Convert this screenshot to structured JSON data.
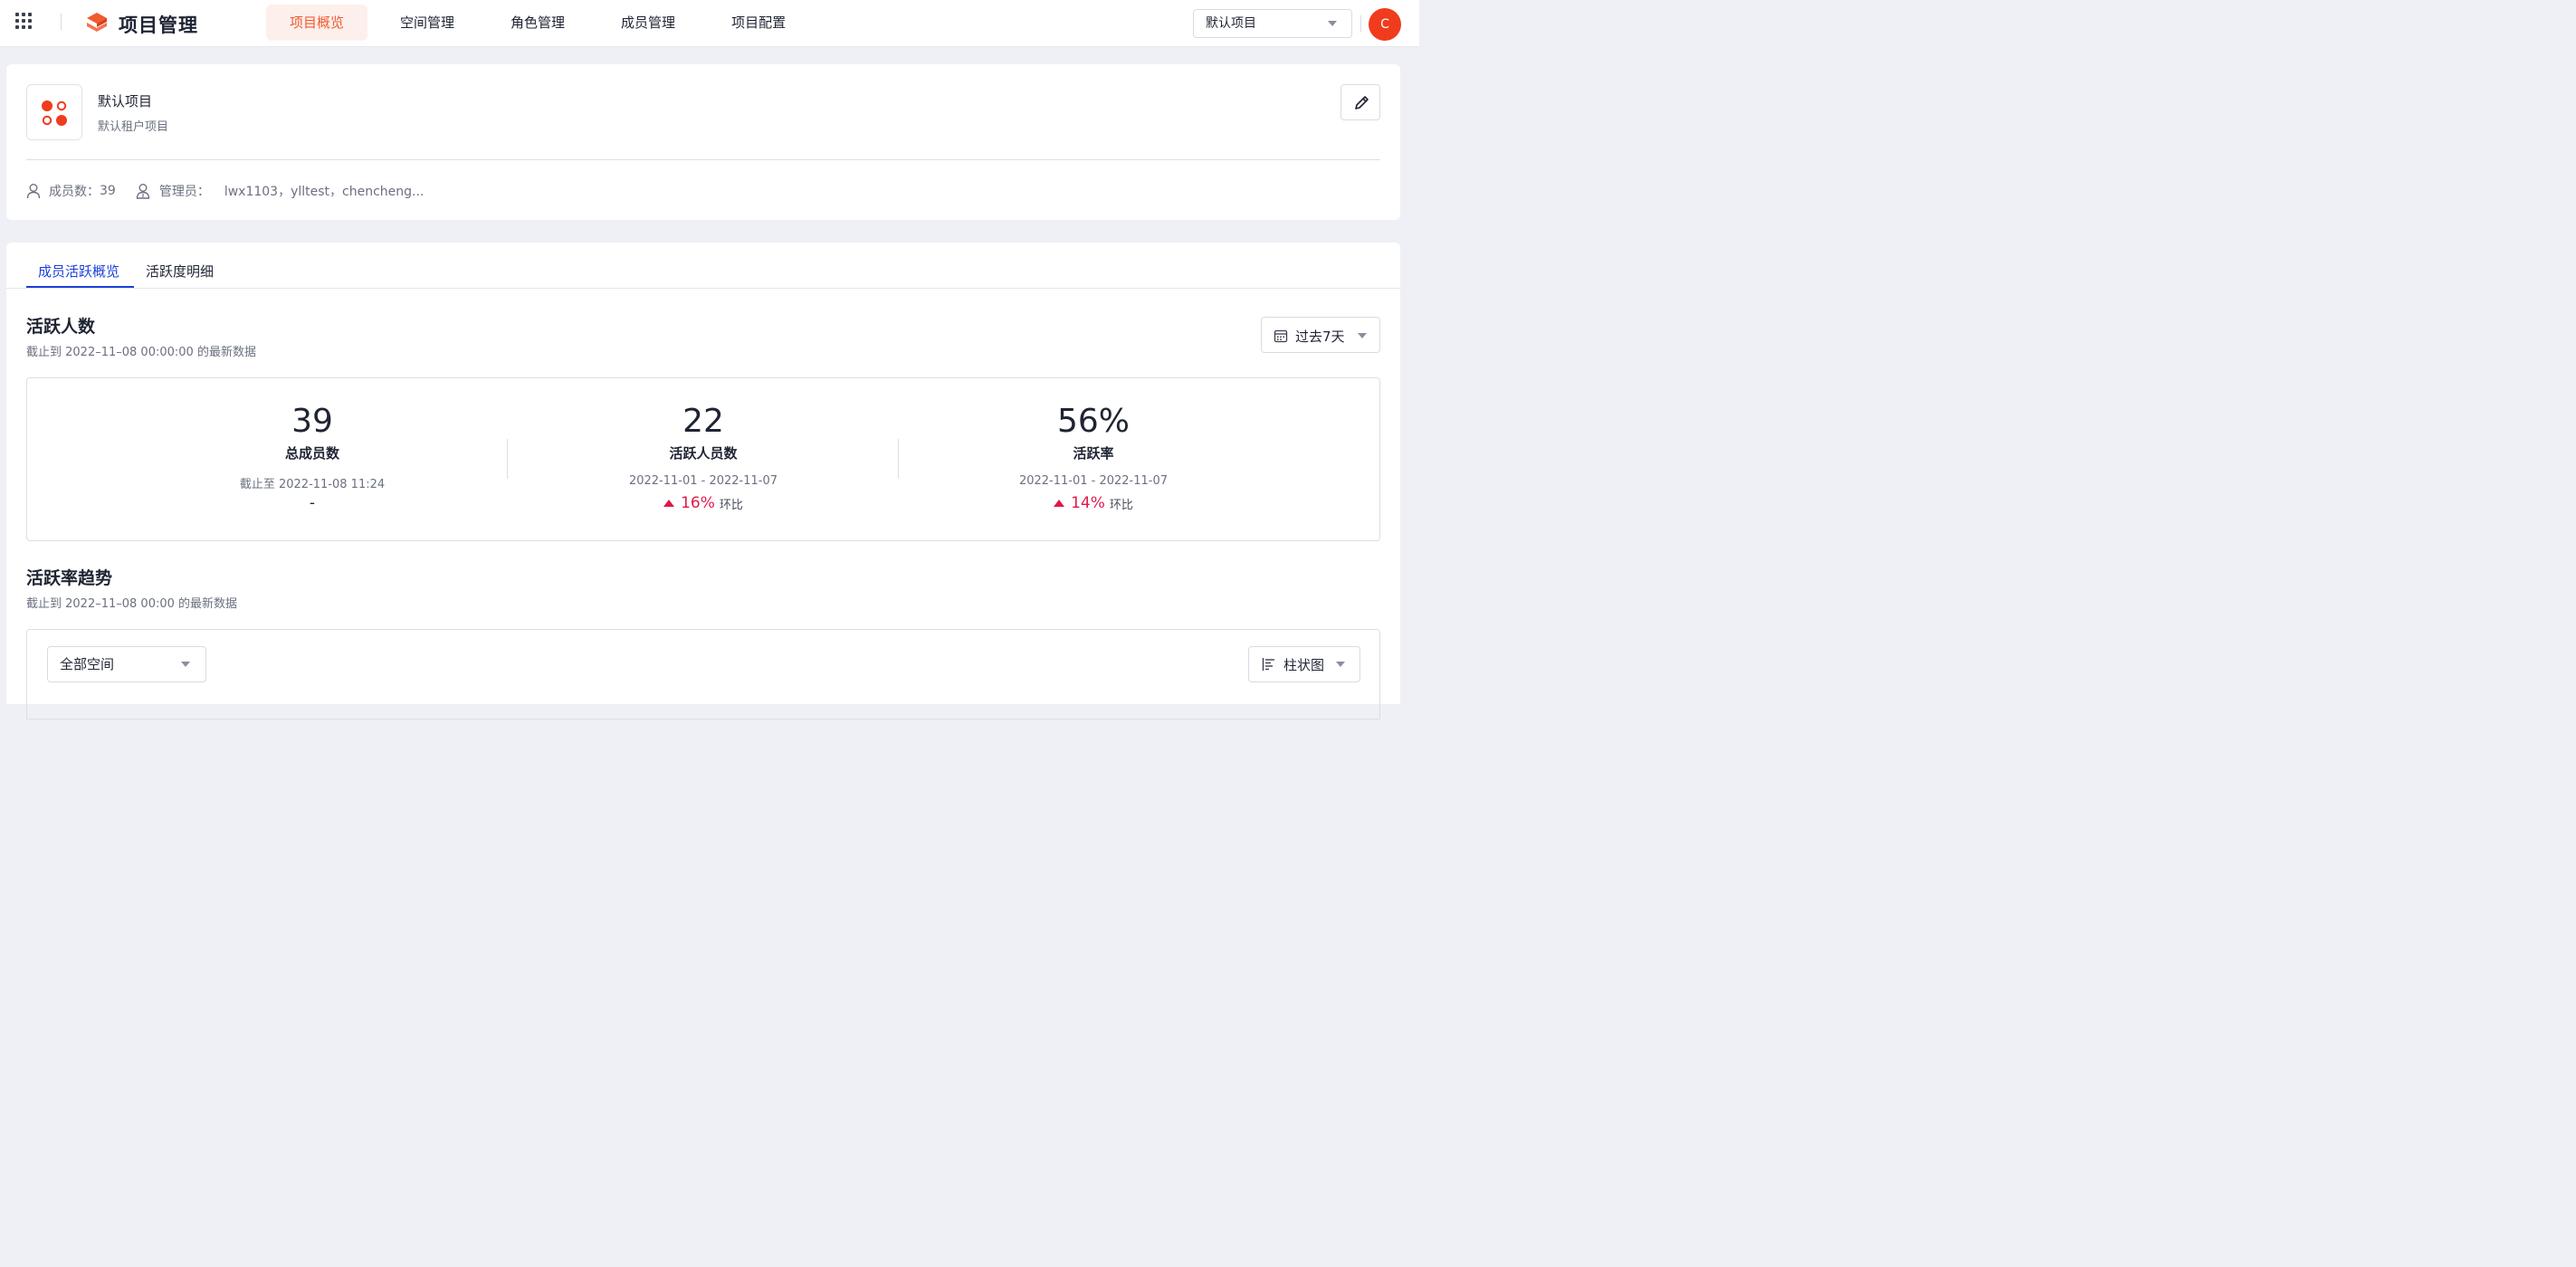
{
  "topbar": {
    "brand": "项目管理",
    "nav": [
      {
        "label": "项目概览",
        "active": true
      },
      {
        "label": "空间管理",
        "active": false
      },
      {
        "label": "角色管理",
        "active": false
      },
      {
        "label": "成员管理",
        "active": false
      },
      {
        "label": "项目配置",
        "active": false
      }
    ],
    "project_select": "默认项目",
    "avatar_letter": "C",
    "accent_color": "#f25a2f"
  },
  "project": {
    "name": "默认项目",
    "description": "默认租户项目",
    "members_label": "成员数：",
    "members_count": "39",
    "admins_label": "管理员：",
    "admins_value": "lwx1103，ylltest，chencheng..."
  },
  "tabs": [
    {
      "label": "成员活跃概览",
      "active": true
    },
    {
      "label": "活跃度明细",
      "active": false
    }
  ],
  "active_users": {
    "title": "活跃人数",
    "subtitle": "截止到 2022–11–08 00:00:00 的最新数据",
    "range_select": "过去7天",
    "stats": [
      {
        "value": "39",
        "label": "总成员数",
        "range": "截止至 2022-11-08 11:24",
        "change": "-"
      },
      {
        "value": "22",
        "label": "活跃人员数",
        "range": "2022-11-01 - 2022-11-07",
        "change_pct": "16%",
        "change_label": "环比",
        "direction": "up"
      },
      {
        "value": "56%",
        "label": "活跃率",
        "range": "2022-11-01 - 2022-11-07",
        "change_pct": "14%",
        "change_label": "环比",
        "direction": "up"
      }
    ],
    "up_color": "#e0184a"
  },
  "trend": {
    "title": "活跃率趋势",
    "subtitle": "截止到 2022–11–08 00:00 的最新数据",
    "space_select": "全部空间",
    "chart_type_select": "柱状图"
  }
}
